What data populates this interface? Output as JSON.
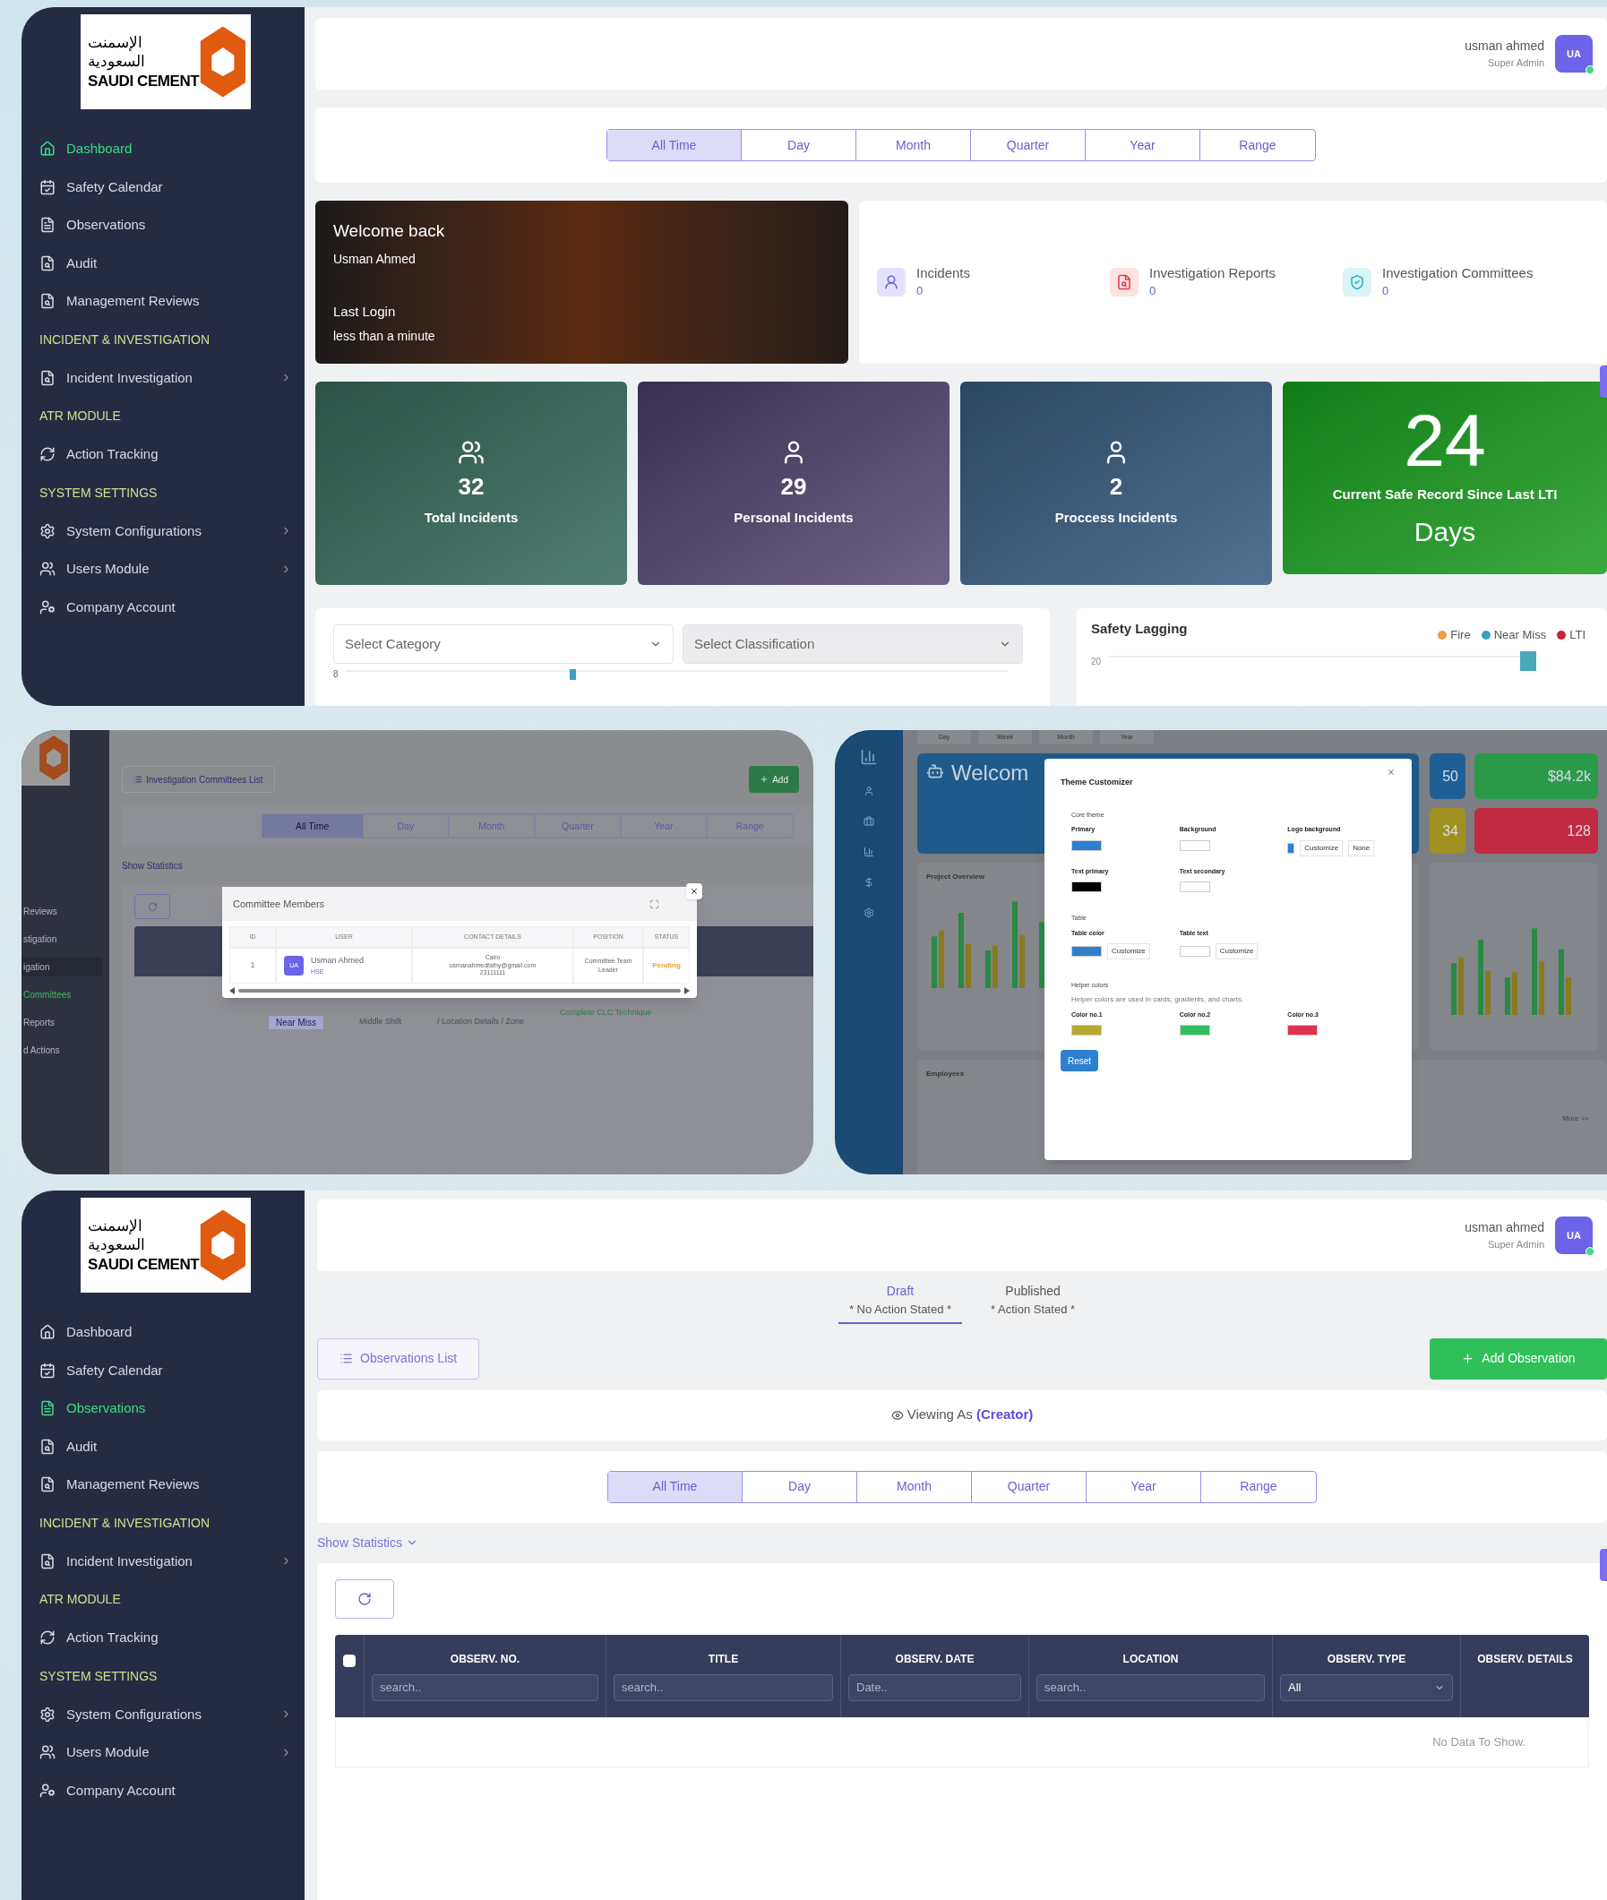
{
  "dashboard": {
    "sidebar": {
      "logo": {
        "arabic": "الإسمنت السعودية",
        "name": "SAUDI CEMENT"
      },
      "items": [
        {
          "kind": "link",
          "label": "Dashboard",
          "selected": true,
          "submenu": false
        },
        {
          "kind": "link",
          "label": "Safety Calendar",
          "selected": false,
          "submenu": false
        },
        {
          "kind": "link",
          "label": "Observations",
          "selected": false,
          "submenu": false
        },
        {
          "kind": "link",
          "label": "Audit",
          "selected": false,
          "submenu": false
        },
        {
          "kind": "link",
          "label": "Management Reviews",
          "selected": false,
          "submenu": false
        },
        {
          "kind": "heading",
          "label": "INCIDENT & INVESTIGATION"
        },
        {
          "kind": "link",
          "label": "Incident Investigation",
          "selected": false,
          "submenu": true
        },
        {
          "kind": "heading",
          "label": "ATR MODULE"
        },
        {
          "kind": "link",
          "label": "Action Tracking",
          "selected": false,
          "submenu": false
        },
        {
          "kind": "heading",
          "label": "SYSTEM SETTINGS"
        },
        {
          "kind": "link",
          "label": "System Configurations",
          "selected": false,
          "submenu": true
        },
        {
          "kind": "link",
          "label": "Users Module",
          "selected": false,
          "submenu": true
        },
        {
          "kind": "link",
          "label": "Company Account",
          "selected": false,
          "submenu": false
        }
      ]
    },
    "header": {
      "user": "usman ahmed",
      "role": "Super Admin",
      "initials": "UA",
      "online": true
    },
    "periods": [
      {
        "label": "All Time",
        "selected": true
      },
      {
        "label": "Day",
        "selected": false
      },
      {
        "label": "Month",
        "selected": false
      },
      {
        "label": "Quarter",
        "selected": false
      },
      {
        "label": "Year",
        "selected": false
      },
      {
        "label": "Range",
        "selected": false
      }
    ],
    "welcome": {
      "title": "Welcome back",
      "name": "Usman Ahmed",
      "login_label": "Last Login",
      "login_value": "less than a minute"
    },
    "summary": [
      {
        "label": "Incidents",
        "value": "0"
      },
      {
        "label": "Investigation Reports",
        "value": "0"
      },
      {
        "label": "Investigation Committees",
        "value": "0"
      }
    ],
    "metrics": [
      {
        "kind": "count",
        "value": "32",
        "label": "Total Incidents"
      },
      {
        "kind": "count",
        "value": "29",
        "label": "Personal Incidents"
      },
      {
        "kind": "count",
        "value": "2",
        "label": "Proccess Incidents"
      },
      {
        "kind": "record",
        "value": "24",
        "label": "Current Safe Record Since Last LTI",
        "unit": "Days"
      }
    ],
    "filters": [
      {
        "label": "Select Category",
        "disabled": false
      },
      {
        "label": "Select Classification",
        "disabled": true
      }
    ],
    "category_chart_tick": "8",
    "safety_lagging": {
      "title": "Safety Lagging",
      "legend": [
        {
          "label": "Fire",
          "color": "#e8a040"
        },
        {
          "label": "Near Miss",
          "color": "#3aa0c0"
        },
        {
          "label": "LTI",
          "color": "#d0203a"
        }
      ],
      "y_tick": "20"
    }
  },
  "committees_view": {
    "sidebar_items": [
      {
        "label": "Reviews",
        "selected": false,
        "expanded": false
      },
      {
        "label": "stigation",
        "selected": false,
        "expanded": false
      },
      {
        "label": "igation",
        "selected": false,
        "expanded": true
      },
      {
        "label": "Committees",
        "selected": true,
        "expanded": false
      },
      {
        "label": "Reports",
        "selected": false,
        "expanded": false
      },
      {
        "label": "d Actions",
        "selected": false,
        "expanded": false
      }
    ],
    "list_button": "Investigation Committees List",
    "add_button": "Add",
    "periods": [
      {
        "label": "All Time",
        "selected": true
      },
      {
        "label": "Day",
        "selected": false
      },
      {
        "label": "Month",
        "selected": false
      },
      {
        "label": "Quarter",
        "selected": false
      },
      {
        "label": "Year",
        "selected": false
      },
      {
        "label": "Range",
        "selected": false
      }
    ],
    "show_statistics": "Show Statistics",
    "row": {
      "tag": "Near Miss",
      "shift": "Middle Shift",
      "location": "/ Location Details / Zone",
      "technique": "Complete CLC Technique"
    },
    "modal": {
      "title": "Committee Members",
      "columns": [
        "ID",
        "USER",
        "CONTACT DETAILS",
        "POSITION",
        "STATUS"
      ],
      "row": {
        "id": "1",
        "initials": "UA",
        "name": "Usman Ahmed",
        "role": "HSE",
        "contact": [
          "Cairo",
          "usmanahmedfathy@gmail.com",
          "23111111"
        ],
        "position": "Committee Team Leader",
        "status": "Pending"
      }
    }
  },
  "theme_view": {
    "tabs": [
      "Day",
      "Week",
      "Month",
      "Year"
    ],
    "welcome": "Welcom",
    "stats": [
      {
        "value": "50",
        "color": "#1f5f95"
      },
      {
        "value": "$84.2k",
        "color": "#2a9a4a"
      },
      {
        "value": "34",
        "color": "#a09020"
      },
      {
        "value": "128",
        "color": "#c02a40"
      }
    ],
    "project_overview": "Project Overview",
    "employees": "Employees",
    "more": "More >>",
    "modal": {
      "title": "Theme Customizer",
      "sections": [
        {
          "title": "Core theme",
          "fields": [
            {
              "label": "Primary",
              "color": "#2f7fd0"
            },
            {
              "label": "Background",
              "color": "#ffffff"
            },
            {
              "label": "Logo background",
              "color": "#2f7fd0",
              "buttons": [
                "Customize",
                "None"
              ]
            },
            {
              "label": "Text primary",
              "color": "#000000"
            },
            {
              "label": "Text secondary",
              "color": "#ffffff"
            }
          ]
        },
        {
          "title": "Table",
          "fields": [
            {
              "label": "Table color",
              "color": "#2f7fd0",
              "buttons": [
                "Customize"
              ]
            },
            {
              "label": "Table text",
              "color": "#ffffff",
              "buttons": [
                "Customize"
              ]
            }
          ]
        },
        {
          "title": "Helper colors",
          "note": "Helper colors are used in cards, gradients, and charts.",
          "fields": [
            {
              "label": "Color no.1",
              "color": "#b8a830"
            },
            {
              "label": "Color no.2",
              "color": "#30c060"
            },
            {
              "label": "Color no.3",
              "color": "#e03050"
            }
          ]
        }
      ],
      "reset": "Reset"
    }
  },
  "observations": {
    "sidebar": {
      "logo": {
        "arabic": "الإسمنت السعودية",
        "name": "SAUDI CEMENT"
      },
      "items": [
        {
          "kind": "link",
          "label": "Dashboard",
          "selected": false,
          "submenu": false
        },
        {
          "kind": "link",
          "label": "Safety Calendar",
          "selected": false,
          "submenu": false
        },
        {
          "kind": "link",
          "label": "Observations",
          "selected": true,
          "submenu": false
        },
        {
          "kind": "link",
          "label": "Audit",
          "selected": false,
          "submenu": false
        },
        {
          "kind": "link",
          "label": "Management Reviews",
          "selected": false,
          "submenu": false
        },
        {
          "kind": "heading",
          "label": "INCIDENT & INVESTIGATION"
        },
        {
          "kind": "link",
          "label": "Incident Investigation",
          "selected": false,
          "submenu": true
        },
        {
          "kind": "heading",
          "label": "ATR MODULE"
        },
        {
          "kind": "link",
          "label": "Action Tracking",
          "selected": false,
          "submenu": false
        },
        {
          "kind": "heading",
          "label": "SYSTEM SETTINGS"
        },
        {
          "kind": "link",
          "label": "System Configurations",
          "selected": false,
          "submenu": true
        },
        {
          "kind": "link",
          "label": "Users Module",
          "selected": false,
          "submenu": true
        },
        {
          "kind": "link",
          "label": "Company Account",
          "selected": false,
          "submenu": false
        }
      ]
    },
    "header": {
      "user": "usman ahmed",
      "role": "Super Admin",
      "initials": "UA",
      "online": true
    },
    "status_tabs": [
      {
        "label": "Draft",
        "sub": "* No Action Stated *",
        "selected": true
      },
      {
        "label": "Published",
        "sub": "* Action Stated *",
        "selected": false
      }
    ],
    "list_button": "Observations List",
    "add_button": "Add Observation",
    "viewing": "Viewing As **(Creator)**",
    "periods": [
      {
        "label": "All Time",
        "selected": true
      },
      {
        "label": "Day",
        "selected": false
      },
      {
        "label": "Month",
        "selected": false
      },
      {
        "label": "Quarter",
        "selected": false
      },
      {
        "label": "Year",
        "selected": false
      },
      {
        "label": "Range",
        "selected": false
      }
    ],
    "show_statistics": "Show Statistics",
    "table": {
      "columns": [
        {
          "title": "OBSERV. NO.",
          "filter": {
            "kind": "text",
            "placeholder": "search.."
          }
        },
        {
          "title": "TITLE",
          "filter": {
            "kind": "text",
            "placeholder": "search.."
          }
        },
        {
          "title": "OBSERV. DATE",
          "filter": {
            "kind": "text",
            "placeholder": "Date.."
          }
        },
        {
          "title": "LOCATION",
          "filter": {
            "kind": "text",
            "placeholder": "search.."
          }
        },
        {
          "title": "OBSERV. TYPE",
          "filter": {
            "kind": "select",
            "value": "All"
          }
        },
        {
          "title": "OBSERV. DETAILS",
          "filter": {
            "kind": "none"
          }
        }
      ],
      "select_all_checked": false,
      "empty": "No Data To Show."
    }
  }
}
